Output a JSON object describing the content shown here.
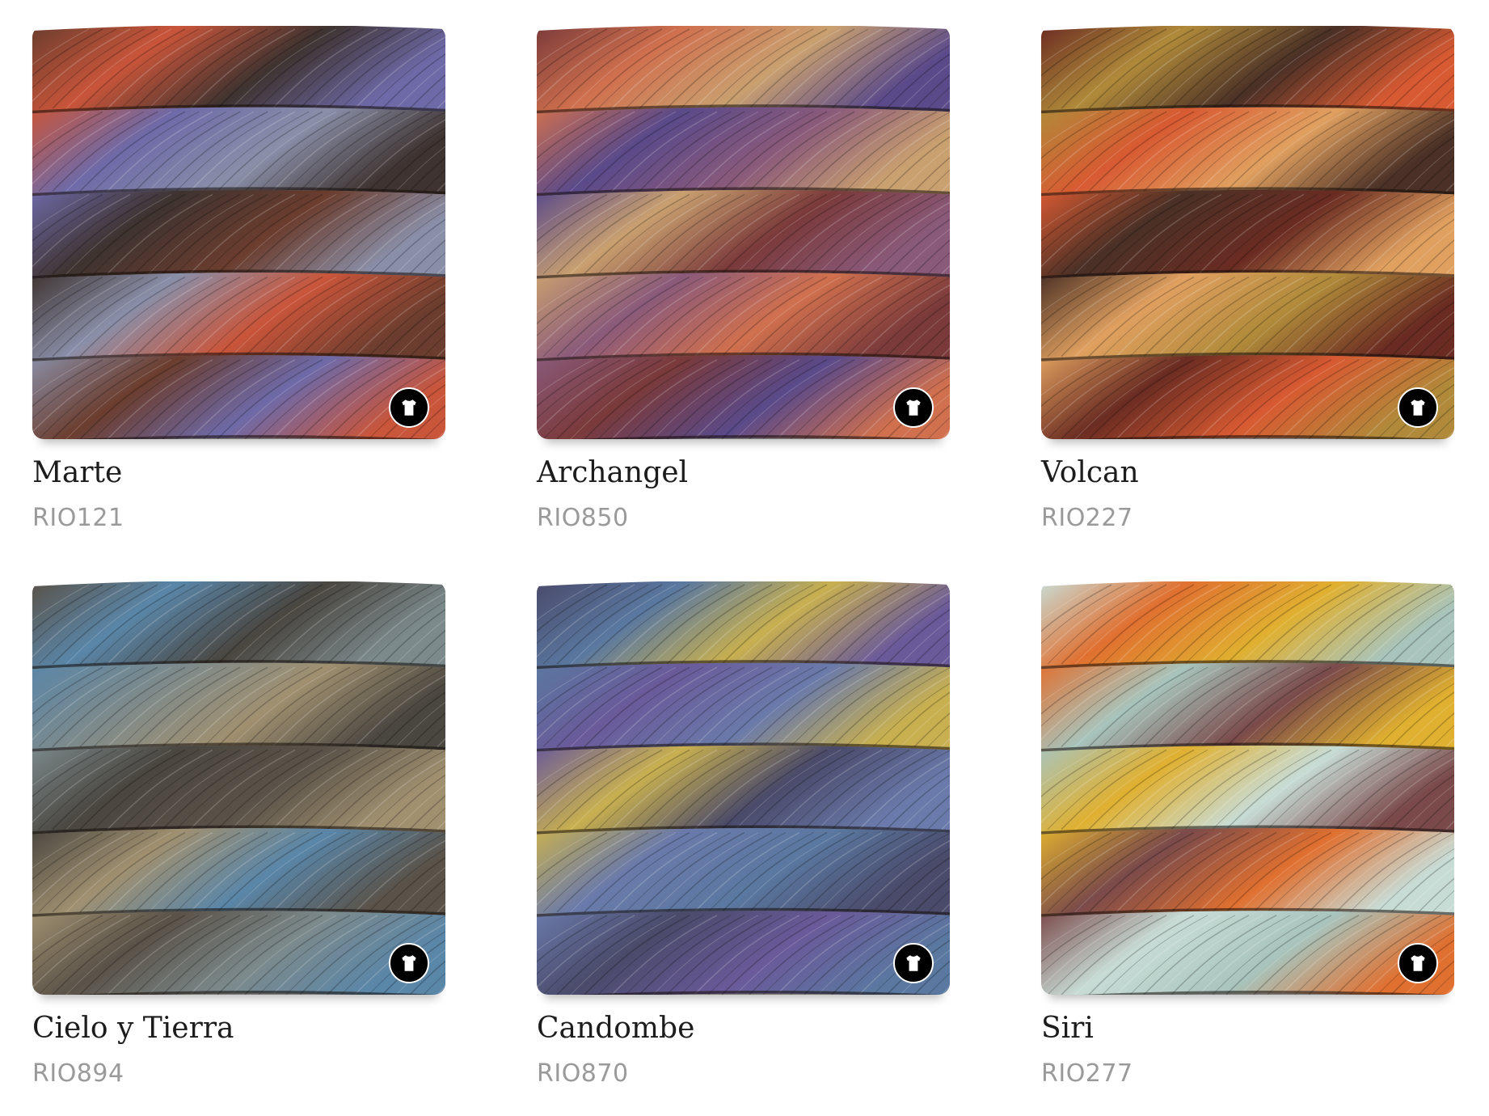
{
  "products": [
    {
      "name": "Marte",
      "code": "RIO121",
      "colors": [
        "#6b3d2e",
        "#c9553a",
        "#6e6aa8",
        "#3e3330",
        "#8a8fa8"
      ]
    },
    {
      "name": "Archangel",
      "code": "RIO850",
      "colors": [
        "#7a3a3a",
        "#d0704e",
        "#5a4a8a",
        "#c9a070",
        "#8a5a7a"
      ]
    },
    {
      "name": "Volcan",
      "code": "RIO227",
      "colors": [
        "#6a2c22",
        "#b08a3a",
        "#d85a32",
        "#4a3026",
        "#e0a060"
      ]
    },
    {
      "name": "Cielo y Tierra",
      "code": "RIO894",
      "colors": [
        "#5a5248",
        "#5a86a8",
        "#7c8a8c",
        "#4a4640",
        "#a09070"
      ]
    },
    {
      "name": "Candombe",
      "code": "RIO870",
      "colors": [
        "#4a4a6a",
        "#5a78a0",
        "#6a5a9a",
        "#c8b050",
        "#6a7aaa"
      ]
    },
    {
      "name": "Siri",
      "code": "RIO277",
      "colors": [
        "#c8dcd6",
        "#e07030",
        "#a8c4bc",
        "#e0b030",
        "#7a4a4a"
      ]
    }
  ]
}
